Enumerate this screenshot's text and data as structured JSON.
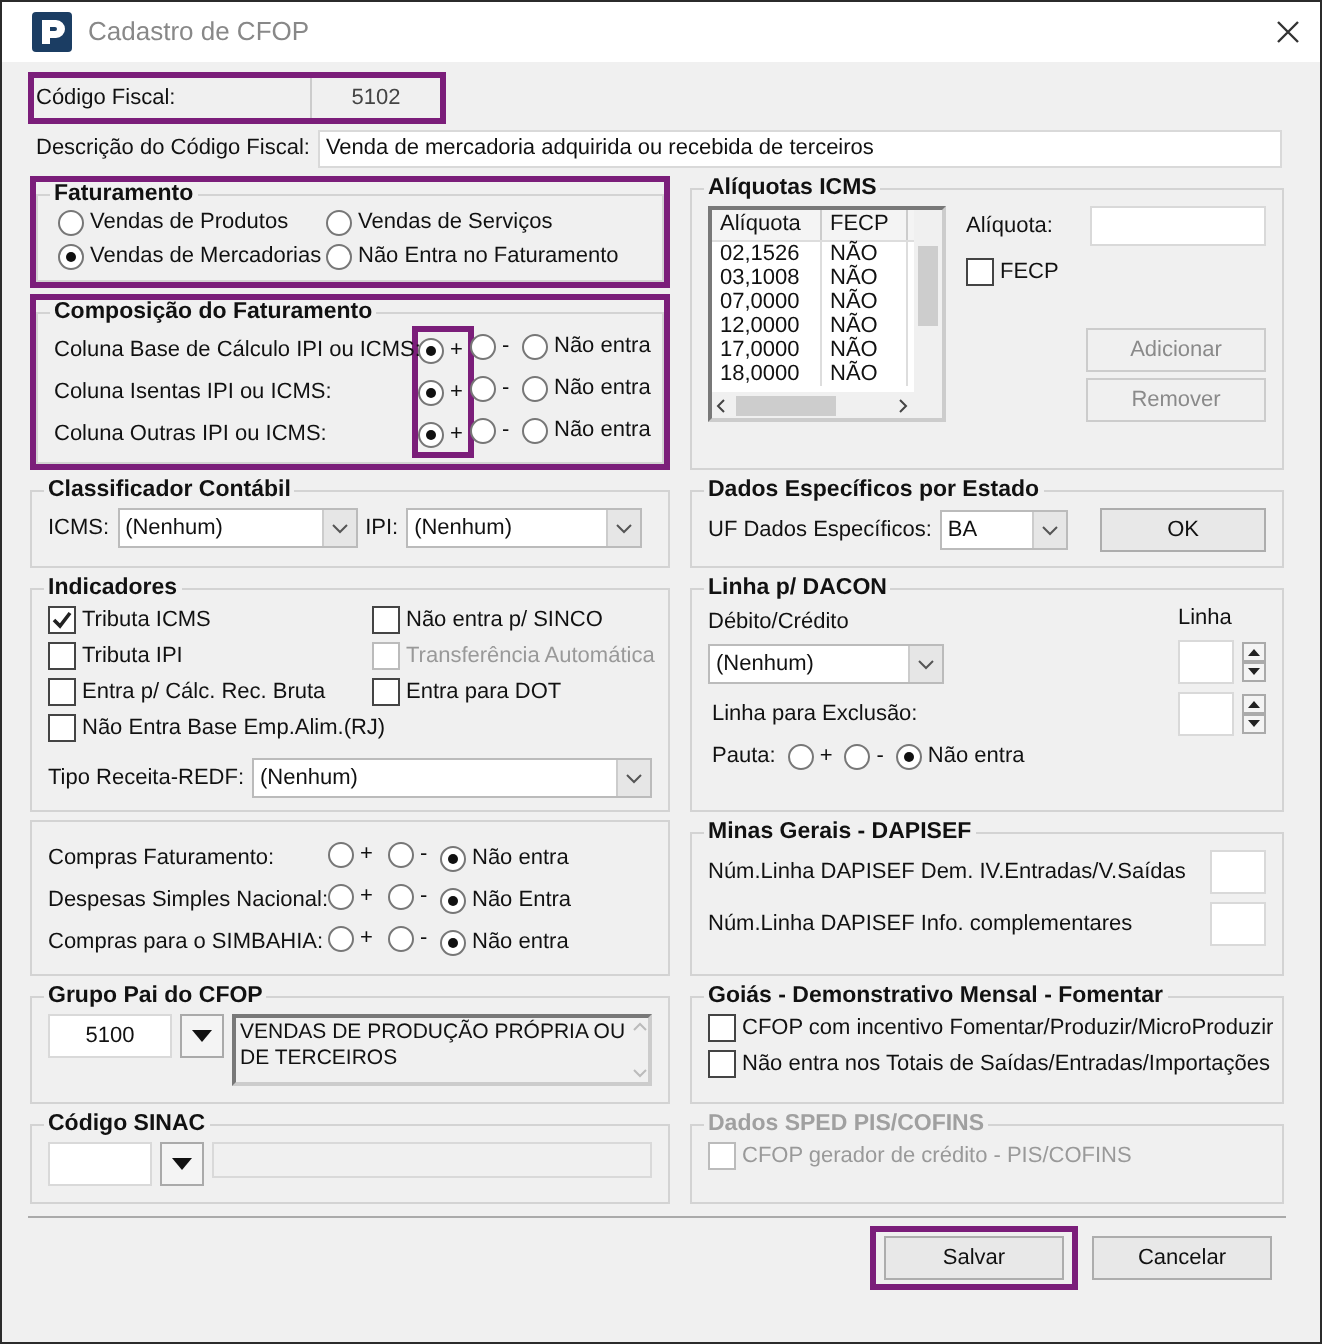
{
  "window": {
    "title": "Cadastro de CFOP"
  },
  "codigo_fiscal": {
    "label": "Código Fiscal:",
    "value": "5102",
    "highlighted": true
  },
  "descricao": {
    "label": "Descrição do Código Fiscal:",
    "value": "Venda de mercadoria adquirida ou recebida de terceiros"
  },
  "faturamento": {
    "title": "Faturamento",
    "highlighted": true,
    "options": [
      {
        "label": "Vendas de Produtos",
        "selected": false
      },
      {
        "label": "Vendas de Serviços",
        "selected": false
      },
      {
        "label": "Vendas de Mercadorias",
        "selected": true
      },
      {
        "label": "Não Entra no Faturamento",
        "selected": false
      }
    ]
  },
  "composicao": {
    "title": "Composição do Faturamento",
    "plus_column_highlighted": true,
    "rows": [
      {
        "label": "Coluna Base de Cálculo IPI ou ICMS:",
        "options": [
          {
            "label": "+",
            "selected": true
          },
          {
            "label": "-",
            "selected": false
          },
          {
            "label": "Não entra",
            "selected": false
          }
        ]
      },
      {
        "label": "Coluna Isentas IPI ou ICMS:",
        "options": [
          {
            "label": "+",
            "selected": true
          },
          {
            "label": "-",
            "selected": false
          },
          {
            "label": "Não entra",
            "selected": false
          }
        ]
      },
      {
        "label": "Coluna Outras IPI ou ICMS:",
        "options": [
          {
            "label": "+",
            "selected": true
          },
          {
            "label": "-",
            "selected": false
          },
          {
            "label": "Não entra",
            "selected": false
          }
        ]
      }
    ]
  },
  "aliquotas_icms": {
    "title": "Alíquotas ICMS",
    "columns": [
      "Alíquota",
      "FECP"
    ],
    "rows": [
      [
        "02,1526",
        "NÃO"
      ],
      [
        "03,1008",
        "NÃO"
      ],
      [
        "07,0000",
        "NÃO"
      ],
      [
        "12,0000",
        "NÃO"
      ],
      [
        "17,0000",
        "NÃO"
      ],
      [
        "18,0000",
        "NÃO"
      ]
    ],
    "aliquota_label": "Alíquota:",
    "fecp": {
      "label": "FECP",
      "checked": false
    },
    "buttons": [
      {
        "label": "Adicionar",
        "disabled": true
      },
      {
        "label": "Remover",
        "disabled": true
      }
    ]
  },
  "classificador_contabil": {
    "title": "Classificador Contábil",
    "fields": [
      {
        "label": "ICMS:",
        "value": "(Nenhum)"
      },
      {
        "label": "IPI:",
        "value": "(Nenhum)"
      }
    ]
  },
  "dados_especificos": {
    "title": "Dados Específicos por Estado",
    "label": "UF Dados Específicos:",
    "value": "BA",
    "button": "OK"
  },
  "indicadores": {
    "title": "Indicadores",
    "checkboxes": [
      {
        "label": "Tributa ICMS",
        "checked": true,
        "disabled": false
      },
      {
        "label": "Não entra p/ SINCO",
        "checked": false,
        "disabled": false
      },
      {
        "label": "Tributa IPI",
        "checked": false,
        "disabled": false
      },
      {
        "label": "Transferência Automática",
        "checked": false,
        "disabled": true
      },
      {
        "label": "Entra p/ Cálc. Rec. Bruta",
        "checked": false,
        "disabled": false
      },
      {
        "label": "Entra para DOT",
        "checked": false,
        "disabled": false
      },
      {
        "label": "Não Entra Base Emp.Alim.(RJ)",
        "checked": false,
        "disabled": false
      }
    ],
    "tipo_receita": {
      "label": "Tipo Receita-REDF:",
      "value": "(Nenhum)"
    }
  },
  "linha_dacon": {
    "title": "Linha p/ DACON",
    "debito_label": "Débito/Crédito",
    "debito_value": "(Nenhum)",
    "linha_label": "Linha",
    "exclusao_label": "Linha para Exclusão:",
    "pauta": {
      "label": "Pauta:",
      "options": [
        {
          "label": "+",
          "selected": false
        },
        {
          "label": "-",
          "selected": false
        },
        {
          "label": "Não entra",
          "selected": true
        }
      ]
    }
  },
  "compras": {
    "rows": [
      {
        "label": "Compras Faturamento:",
        "options": [
          {
            "label": "+",
            "selected": false
          },
          {
            "label": "-",
            "selected": false
          },
          {
            "label": "Não entra",
            "selected": true
          }
        ]
      },
      {
        "label": "Despesas Simples Nacional:",
        "options": [
          {
            "label": "+",
            "selected": false
          },
          {
            "label": "-",
            "selected": false
          },
          {
            "label": "Não Entra",
            "selected": true
          }
        ]
      },
      {
        "label": "Compras para o SIMBAHIA:",
        "options": [
          {
            "label": "+",
            "selected": false
          },
          {
            "label": "-",
            "selected": false
          },
          {
            "label": "Não entra",
            "selected": true
          }
        ]
      }
    ]
  },
  "minas_gerais": {
    "title": "Minas Gerais - DAPISEF",
    "fields": [
      "Núm.Linha DAPISEF Dem. IV.Entradas/V.Saídas",
      "Núm.Linha DAPISEF Info. complementares"
    ]
  },
  "grupo_pai": {
    "title": "Grupo Pai do CFOP",
    "code": "5100",
    "description": "VENDAS DE PRODUÇÃO PRÓPRIA OU DE TERCEIROS"
  },
  "goias": {
    "title": "Goiás - Demonstrativo Mensal - Fomentar",
    "checkboxes": [
      {
        "label": "CFOP com incentivo  Fomentar/Produzir/MicroProduzir",
        "checked": false
      },
      {
        "label": "Não entra nos Totais de  Saídas/Entradas/Importações",
        "checked": false
      }
    ]
  },
  "codigo_sinac": {
    "title": "Código SINAC"
  },
  "sped": {
    "title": "Dados SPED PIS/COFINS",
    "disabled": true,
    "checkboxes": [
      {
        "label": "CFOP gerador de crédito - PIS/COFINS",
        "checked": false
      }
    ]
  },
  "buttons": [
    {
      "label": "Salvar",
      "highlighted": true
    },
    {
      "label": "Cancelar",
      "highlighted": false
    }
  ]
}
